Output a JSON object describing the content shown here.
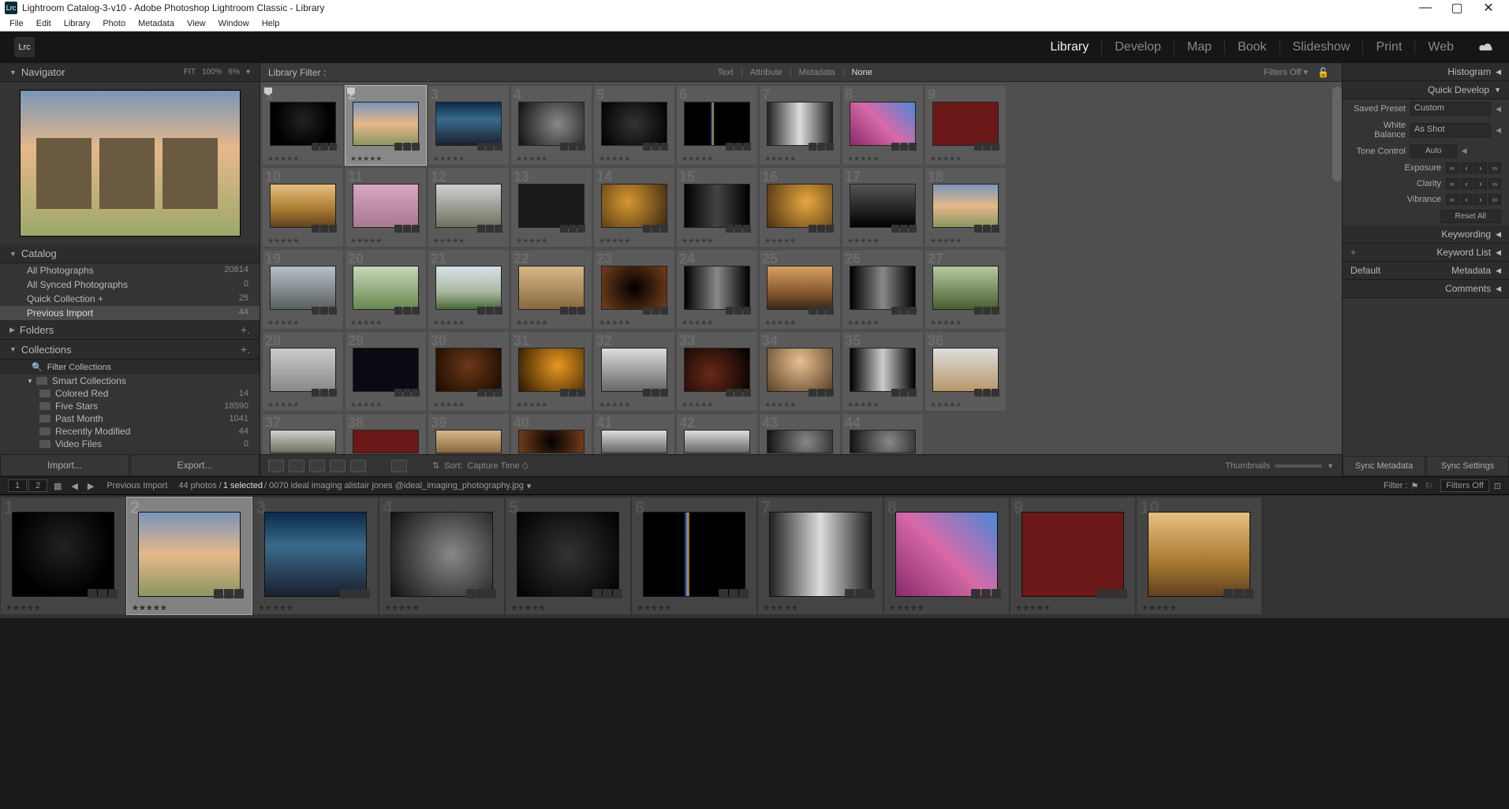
{
  "window": {
    "title": "Lightroom Catalog-3-v10 - Adobe Photoshop Lightroom Classic - Library",
    "lrc": "Lrc"
  },
  "menu": [
    "File",
    "Edit",
    "Library",
    "Photo",
    "Metadata",
    "View",
    "Window",
    "Help"
  ],
  "modules": [
    "Library",
    "Develop",
    "Map",
    "Book",
    "Slideshow",
    "Print",
    "Web"
  ],
  "active_module": "Library",
  "navigator": {
    "title": "Navigator",
    "opts": [
      "FIT",
      "100%",
      "6%"
    ]
  },
  "catalog": {
    "title": "Catalog",
    "items": [
      {
        "label": "All Photographs",
        "count": "20814"
      },
      {
        "label": "All Synced Photographs",
        "count": "0"
      },
      {
        "label": "Quick Collection  +",
        "count": "25"
      },
      {
        "label": "Previous Import",
        "count": "44",
        "sel": true
      }
    ]
  },
  "folders": {
    "title": "Folders"
  },
  "collections": {
    "title": "Collections",
    "filter_placeholder": "Filter Collections",
    "smart_label": "Smart Collections",
    "smart": [
      {
        "label": "Colored Red",
        "count": "14"
      },
      {
        "label": "Five Stars",
        "count": "18590"
      },
      {
        "label": "Past Month",
        "count": "1041"
      },
      {
        "label": "Recently Modified",
        "count": "44"
      },
      {
        "label": "Video Files",
        "count": "0"
      }
    ]
  },
  "left_buttons": {
    "import": "Import...",
    "export": "Export..."
  },
  "library_filter": {
    "label": "Library Filter :",
    "tabs": [
      "Text",
      "Attribute",
      "Metadata",
      "None"
    ],
    "active": "None",
    "filters_off": "Filters Off"
  },
  "toolbar": {
    "sort_label": "Sort:",
    "sort_value": "Capture Time",
    "thumbnails": "Thumbnails"
  },
  "right": {
    "histogram": "Histogram",
    "qd": "Quick Develop",
    "saved_preset_lbl": "Saved Preset",
    "saved_preset_val": "Custom",
    "wb_lbl": "White Balance",
    "wb_val": "As Shot",
    "tone_lbl": "Tone Control",
    "tone_btn": "Auto",
    "exposure": "Exposure",
    "clarity": "Clarity",
    "vibrance": "Vibrance",
    "reset": "Reset All",
    "keywording": "Keywording",
    "keyword_list": "Keyword List",
    "metadata": "Metadata",
    "metadata_val": "Default",
    "comments": "Comments"
  },
  "right_buttons": {
    "sync_meta": "Sync Metadata",
    "sync_settings": "Sync Settings"
  },
  "filmstrip_hdr": {
    "view1": "1",
    "view2": "2",
    "crumb": "Previous Import",
    "count": "44 photos /",
    "selected": "1 selected",
    "path": "/ 0070 ideal imaging alistair jones  @ideal_imaging_photography.jpg",
    "filter_lbl": "Filter :",
    "filter_val": "Filters Off"
  },
  "grid_total": 44,
  "grid_selected_index": 2,
  "filmstrip_selected_index": 2
}
